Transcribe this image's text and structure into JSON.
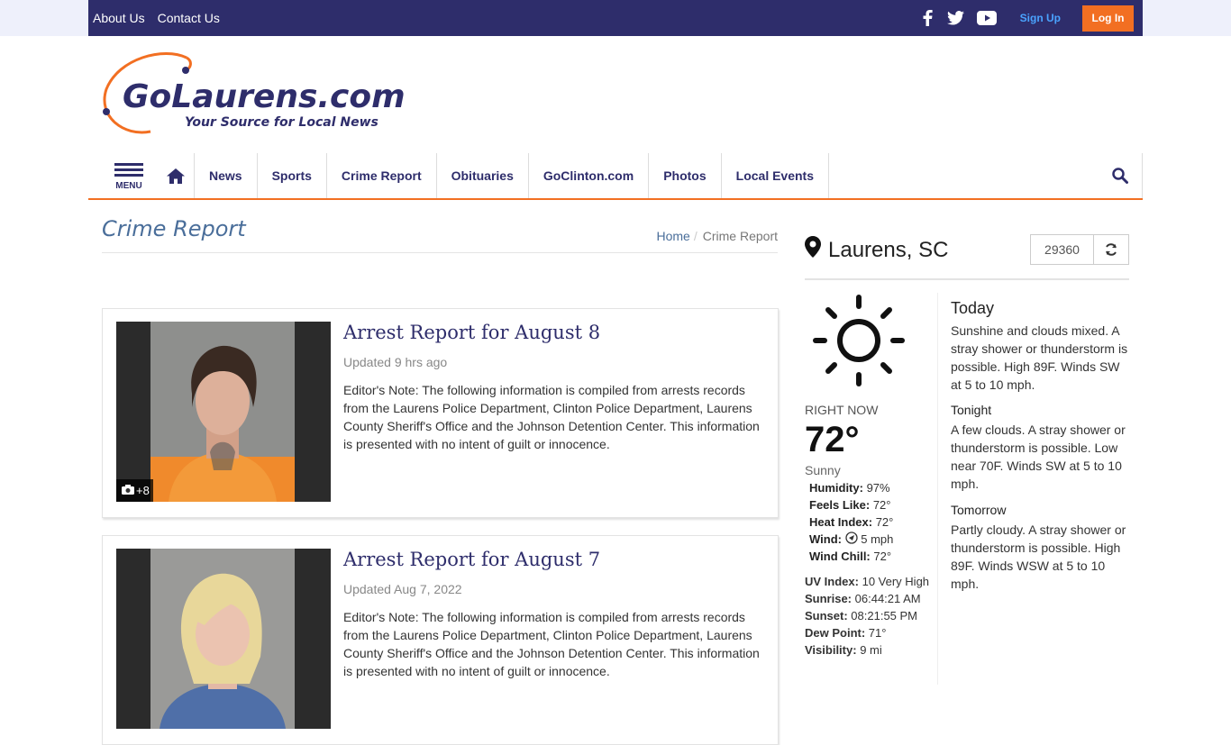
{
  "topbar": {
    "about": "About Us",
    "contact": "Contact Us",
    "signup": "Sign Up",
    "login": "Log In",
    "social_icons": [
      "facebook-icon",
      "twitter-icon",
      "youtube-icon"
    ]
  },
  "logo": {
    "name": "GoLaurens.com",
    "tagline": "Your Source for Local News"
  },
  "nav": {
    "menu_label": "MENU",
    "items": [
      "News",
      "Sports",
      "Crime Report",
      "Obituaries",
      "GoClinton.com",
      "Photos",
      "Local Events"
    ]
  },
  "page": {
    "title": "Crime Report",
    "breadcrumb_home": "Home",
    "breadcrumb_sep": "/",
    "breadcrumb_current": "Crime Report"
  },
  "articles": [
    {
      "headline": "Arrest Report for August 8",
      "updated": "Updated 9 hrs ago",
      "summary": "Editor's Note: The following information is compiled from arrests records from the Laurens Police Department, Clinton Police Department, Laurens County Sheriff's Office and the Johnson Detention Center. This information is presented with no intent of guilt or innocence.",
      "photo_count": "+8"
    },
    {
      "headline": "Arrest Report for August 7",
      "updated": "Updated Aug 7, 2022",
      "summary": "Editor's Note: The following information is compiled from arrests records from the Laurens Police Department, Clinton Police Department, Laurens County Sheriff's Office and the Johnson Detention Center. This information is presented with no intent of guilt or innocence."
    }
  ],
  "weather": {
    "location": "Laurens, SC",
    "zip": "29360",
    "now_label": "RIGHT NOW",
    "temp": "72°",
    "condition": "Sunny",
    "humidity_label": "Humidity:",
    "humidity": "97%",
    "feels_label": "Feels Like:",
    "feels": "72°",
    "heat_label": "Heat Index:",
    "heat": "72°",
    "wind_label": "Wind:",
    "wind": "5 mph",
    "chill_label": "Wind Chill:",
    "chill": "72°",
    "uv_label": "UV Index:",
    "uv": "10 Very High",
    "sunrise_label": "Sunrise:",
    "sunrise": "06:44:21 AM",
    "sunset_label": "Sunset:",
    "sunset": "08:21:55 PM",
    "dew_label": "Dew Point:",
    "dew": "71°",
    "vis_label": "Visibility:",
    "vis": "9 mi",
    "forecast": [
      {
        "period": "Today",
        "text": "Sunshine and clouds mixed. A stray shower or thunderstorm is possible. High 89F. Winds SW at 5 to 10 mph."
      },
      {
        "period": "Tonight",
        "text": "A few clouds. A stray shower or thunderstorm is possible. Low near 70F. Winds SW at 5 to 10 mph."
      },
      {
        "period": "Tomorrow",
        "text": "Partly cloudy. A stray shower or thunderstorm is possible. High 89F. Winds WSW at 5 to 10 mph."
      }
    ]
  },
  "colors": {
    "brand_navy": "#2e2d6b",
    "accent_orange": "#f26f22",
    "link_blue": "#4a6e9a"
  }
}
